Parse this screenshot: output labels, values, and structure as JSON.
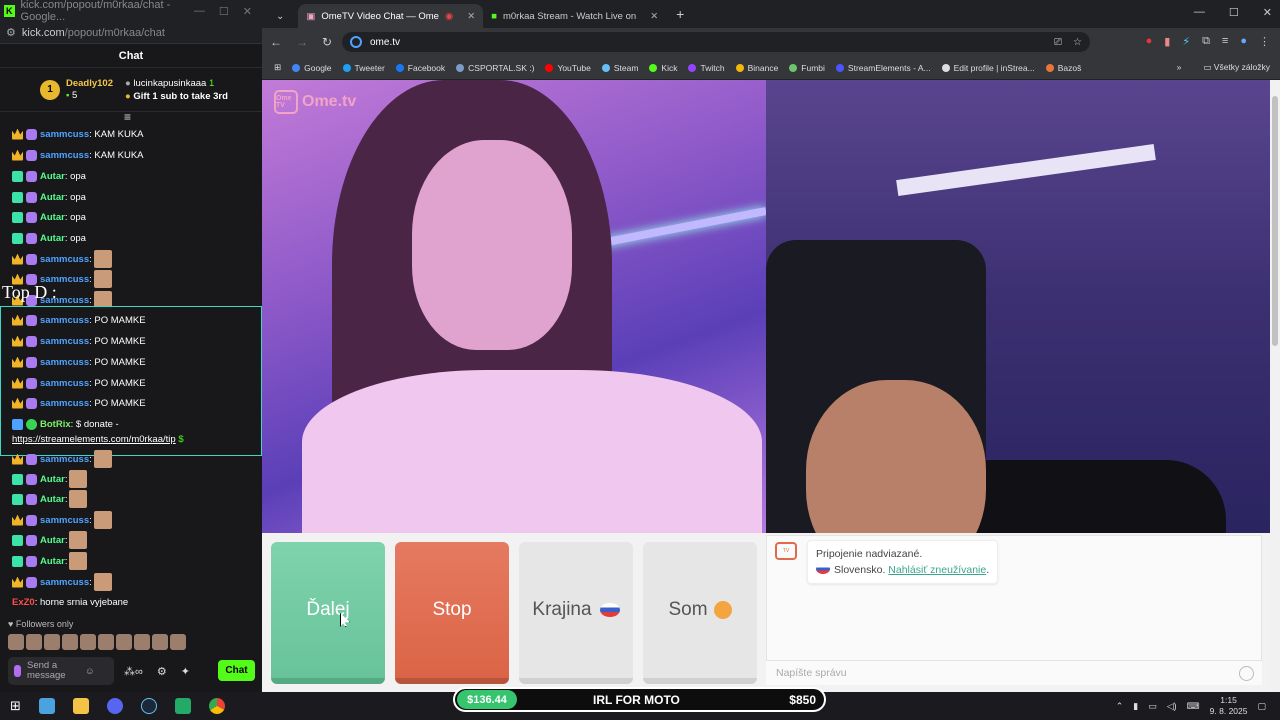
{
  "chatwin": {
    "title": "kick.com/popout/m0rkaa/chat - Google...",
    "url_host": "kick.com",
    "url_path": "/popout/m0rkaa/chat",
    "header": "Chat",
    "leader": {
      "rank": "1",
      "name": "Deadly102",
      "count": "5",
      "gifter": "lucinkapusinkaaa",
      "gift_count": "1",
      "cta": "Gift 1 sub to take 3rd"
    },
    "messages": [
      {
        "user": "sammcuss",
        "text": ": KAM KUKA"
      },
      {
        "user": "sammcuss",
        "text": ": KAM KUKA"
      },
      {
        "user": "Autar",
        "text": ": opa"
      },
      {
        "user": "Autar",
        "text": ": opa"
      },
      {
        "user": "Autar",
        "text": ": opa"
      },
      {
        "user": "Autar",
        "text": ": opa"
      },
      {
        "user": "sammcuss",
        "text": ":"
      },
      {
        "user": "sammcuss",
        "text": ":"
      },
      {
        "user": "sammcuss",
        "text": ":"
      }
    ],
    "overlay_label": "Top D",
    "overlay_messages": [
      {
        "user": "sammcuss",
        "text": ": PO MAMKE"
      },
      {
        "user": "sammcuss",
        "text": ": PO MAMKE"
      },
      {
        "user": "sammcuss",
        "text": ": PO MAMKE"
      },
      {
        "user": "sammcuss",
        "text": ": PO MAMKE"
      },
      {
        "user": "sammcuss",
        "text": ": PO MAMKE"
      }
    ],
    "bot": {
      "user": "BotRix",
      "text": ": $ donate -",
      "link": "https://streamelements.com/m0rkaa/tip",
      "suffix": "$"
    },
    "messages2": [
      {
        "user": "sammcuss",
        "text": ":"
      },
      {
        "user": "Autar",
        "text": ":"
      },
      {
        "user": "Autar",
        "text": ":"
      },
      {
        "user": "sammcuss",
        "text": ":"
      },
      {
        "user": "Autar",
        "text": ":"
      },
      {
        "user": "Autar",
        "text": ":"
      },
      {
        "user": "sammcuss",
        "text": ":"
      },
      {
        "user": "ExZ0",
        "text": ": horne srnia vyjebane"
      }
    ],
    "followers": "Followers only",
    "input_placeholder": "Send a message",
    "chat_button": "Chat"
  },
  "browser": {
    "tabs": [
      {
        "label": "OmeTV Video Chat — Ome"
      },
      {
        "label": "m0rkaa Stream - Watch Live on"
      }
    ],
    "url": "ome.tv",
    "bookmarks": [
      "Google",
      "Tweeter",
      "Facebook",
      "CSPORTAL.SK :)",
      "YouTube",
      "Steam",
      "Kick",
      "Twitch",
      "Binance",
      "Fumbi",
      "StreamElements - A...",
      "Edit profile | inStrea...",
      "Bazoš"
    ],
    "all_bookmarks": "Všetky záložky"
  },
  "page": {
    "logo": "Ome.tv",
    "logo_box": "Ome TV",
    "next": "Ďalej",
    "stop": "Stop",
    "country": "Krajina",
    "me": "Som",
    "sys_line1": "Pripojenie nadviazané.",
    "sys_country": "Slovensko.",
    "report": "Nahlásiť zneužívanie",
    "input_placeholder": "Napíšte správu"
  },
  "overlay_goal": {
    "current": "$136.44",
    "title": "IRL FOR MOTO",
    "target": "$850",
    "progress_fraction": 0.16
  },
  "taskbar": {
    "time": "1:15",
    "date": "9. 8. 2025"
  }
}
